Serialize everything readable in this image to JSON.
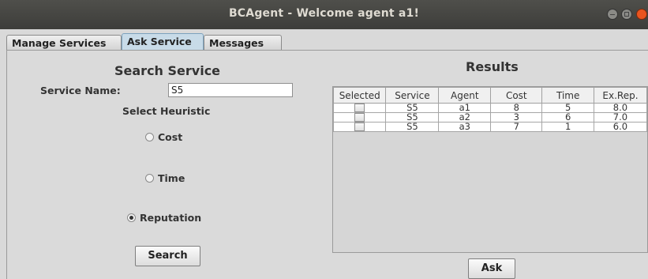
{
  "window": {
    "title": "BCAgent - Welcome agent a1!"
  },
  "tabs": [
    {
      "label": "Manage Services"
    },
    {
      "label": "Ask Service",
      "active": true
    },
    {
      "label": "Messages"
    }
  ],
  "search": {
    "title": "Search Service",
    "service_name_label": "Service Name:",
    "service_name_value": "S5",
    "heuristic_label": "Select Heuristic",
    "options": [
      {
        "label": "Cost",
        "selected": false
      },
      {
        "label": "Time",
        "selected": false
      },
      {
        "label": "Reputation",
        "selected": true
      }
    ],
    "button_label": "Search"
  },
  "results": {
    "title": "Results",
    "columns": [
      "Selected",
      "Service",
      "Agent",
      "Cost",
      "Time",
      "Ex.Rep."
    ],
    "rows": [
      {
        "selected": false,
        "service": "S5",
        "agent": "a1",
        "cost": "8",
        "time": "5",
        "exrep": "8.0"
      },
      {
        "selected": false,
        "service": "S5",
        "agent": "a2",
        "cost": "3",
        "time": "6",
        "exrep": "7.0"
      },
      {
        "selected": false,
        "service": "S5",
        "agent": "a3",
        "cost": "7",
        "time": "1",
        "exrep": "6.0"
      }
    ],
    "button_label": "Ask"
  },
  "colors": {
    "titlebar": "#3f3f3c",
    "close_button": "#e9541f",
    "active_tab": "#c8dbe8"
  }
}
